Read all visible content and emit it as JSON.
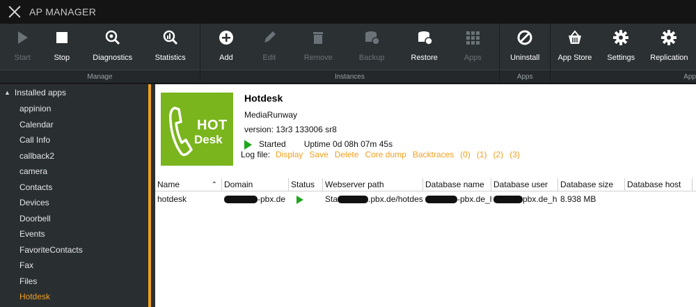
{
  "app": {
    "title": "AP MANAGER"
  },
  "toolbar": {
    "groups": [
      {
        "label": "Manage",
        "buttons": [
          {
            "label": "Start",
            "icon": "play-icon",
            "enabled": false
          },
          {
            "label": "Stop",
            "icon": "stop-icon",
            "enabled": true
          },
          {
            "label": "Diagnostics",
            "icon": "diagnostics-icon",
            "enabled": true
          },
          {
            "label": "Statistics",
            "icon": "statistics-icon",
            "enabled": true
          }
        ]
      },
      {
        "label": "Instances",
        "buttons": [
          {
            "label": "Add",
            "icon": "add-icon",
            "enabled": true
          },
          {
            "label": "Edit",
            "icon": "pencil-icon",
            "enabled": false
          },
          {
            "label": "Remove",
            "icon": "trash-icon",
            "enabled": false
          },
          {
            "label": "Backup",
            "icon": "backup-icon",
            "enabled": false
          },
          {
            "label": "Restore",
            "icon": "restore-icon",
            "enabled": true
          },
          {
            "label": "Apps",
            "icon": "grid-icon",
            "enabled": false
          }
        ]
      },
      {
        "label": "Apps",
        "buttons": [
          {
            "label": "Uninstall",
            "icon": "uninstall-icon",
            "enabled": true
          }
        ]
      },
      {
        "label": "App",
        "buttons": [
          {
            "label": "App Store",
            "icon": "basket-icon",
            "enabled": true
          },
          {
            "label": "Settings",
            "icon": "gear-icon",
            "enabled": true
          },
          {
            "label": "Replication",
            "icon": "gear-icon",
            "enabled": true
          }
        ]
      }
    ]
  },
  "sidebar": {
    "header": "Installed apps",
    "items": [
      "appinion",
      "Calendar",
      "Call Info",
      "callback2",
      "camera",
      "Contacts",
      "Devices",
      "Doorbell",
      "Events",
      "FavoriteContacts",
      "Fax",
      "Files",
      "Hotdesk"
    ],
    "active": "Hotdesk"
  },
  "detail": {
    "logo": {
      "line1": "HOT",
      "line2": "Desk"
    },
    "name": "Hotdesk",
    "vendor": "MediaRunway",
    "version": "version: 13r3 133006 sr8",
    "status": "Started",
    "uptime": "Uptime 0d 08h 07m 45s",
    "logfile_label": "Log file:",
    "log_links": [
      "Display",
      "Save",
      "Delete",
      "Core dump",
      "Backtraces",
      "(0)",
      "(1)",
      "(2)",
      "(3)"
    ]
  },
  "table": {
    "columns": [
      "Name",
      "Domain",
      "Status",
      "Webserver path",
      "Database name",
      "Database user",
      "Database size",
      "Database host"
    ],
    "rows": [
      {
        "name": "hotdesk",
        "domain": "-pbx.de",
        "status": "",
        "webserver_path": ".pbx.de/hotdesk",
        "webserver_path_prefix": "Sta",
        "db_name": "-pbx.de_ho",
        "db_user": "pbx.de_h",
        "db_size": "8.938 MB",
        "db_host": ""
      }
    ]
  },
  "colors": {
    "accent": "#f0a01e",
    "logo_green": "#7ab51d",
    "status_green": "#1fa61f"
  }
}
